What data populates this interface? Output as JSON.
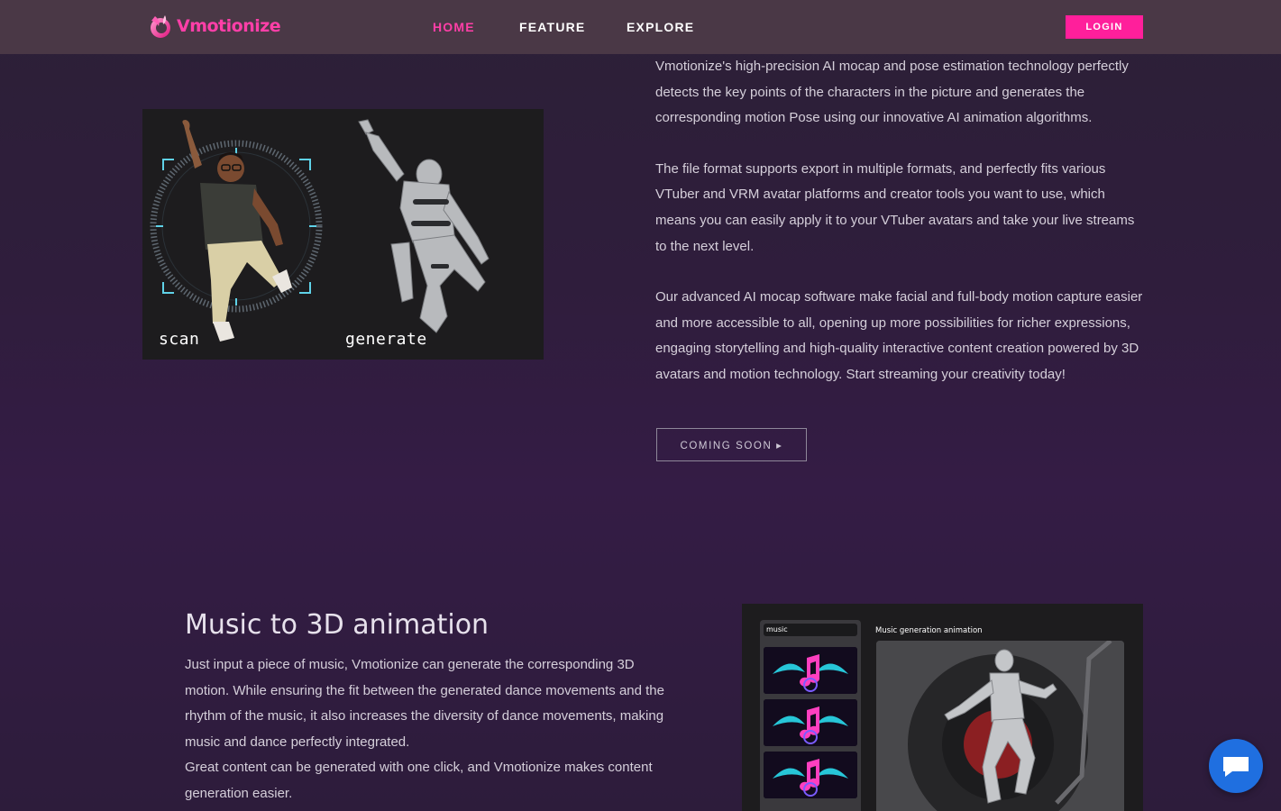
{
  "nav": {
    "logo_text": "Vmotionize",
    "links": [
      "HOME",
      "FEATURE",
      "EXPLORE"
    ],
    "active": "HOME",
    "login_label": "LOGIN"
  },
  "section1": {
    "figure_labels": {
      "scan": "scan",
      "generate": "generate"
    },
    "paragraphs": [
      "Vmotionize's high-precision AI mocap and pose estimation technology perfectly detects the key points of the characters in the picture and generates the corresponding motion Pose using our innovative AI animation algorithms.",
      "The file format supports export in multiple formats, and perfectly fits various VTuber and VRM avatar platforms and creator tools you want to use, which means you can easily apply it to your VTuber avatars and take your live streams to the next level.",
      "Our advanced AI mocap software make facial and full-body motion capture easier and more accessible to all, opening up more possibilities for richer expressions, engaging storytelling and high-quality interactive content creation powered by 3D avatars and motion technology. Start streaming your creativity today!"
    ],
    "cta_label": "COMING SOON ▸"
  },
  "section2": {
    "title": "Music to 3D animation",
    "paragraphs": [
      "Just input a piece of music, Vmotionize can generate the corresponding 3D motion. While ensuring the fit between the generated dance movements and the rhythm of the music, it also increases the diversity of dance movements, making music and dance perfectly integrated.",
      "Great content can be generated with one click, and Vmotionize makes content generation easier."
    ],
    "panel": {
      "music_tab": "music",
      "view_title": "Music generation animation"
    }
  },
  "colors": {
    "accent": "#ff1f9b",
    "nav_bg": "#4a3846",
    "page_bg": "#2f1d3c",
    "chat_bubble": "#1f6fe0"
  },
  "icons": {
    "chat": "chat-bubble-icon",
    "logo": "vmotionize-logo-icon"
  }
}
